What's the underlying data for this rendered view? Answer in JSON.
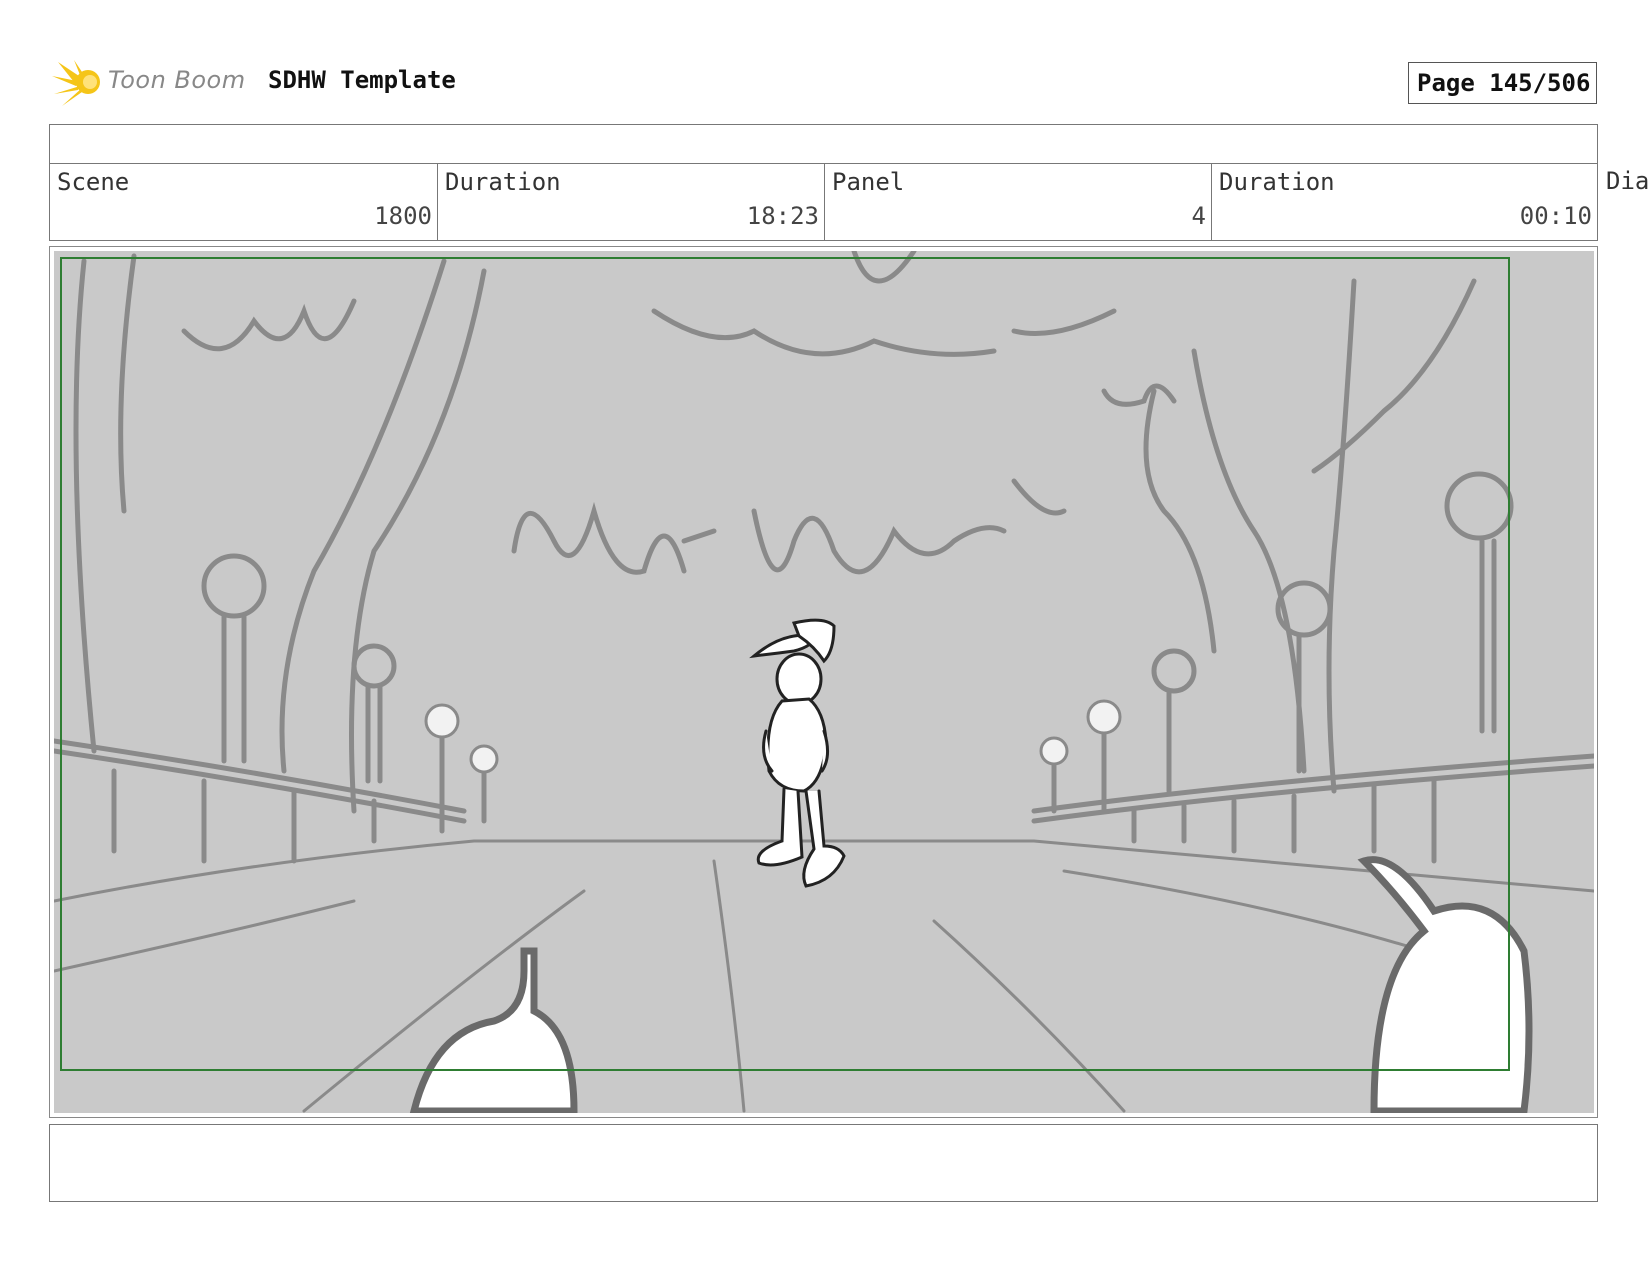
{
  "header": {
    "brand_name": "Toon Boom",
    "document_title": "SDHW Template",
    "page_indicator": "Page 145/506"
  },
  "info_table": {
    "title_row": "",
    "scene_label": "Scene",
    "scene_value": "1800",
    "scene_duration_label": "Duration",
    "scene_duration_value": "18:23",
    "panel_label": "Panel",
    "panel_value": "4",
    "panel_duration_label": "Duration",
    "panel_duration_value": "00:10",
    "dialogue_label": "Dia"
  },
  "panel_image": {
    "icon": "storyboard-sketch-image"
  },
  "notes": {
    "text": ""
  },
  "colors": {
    "logo_yellow": "#f5c518",
    "safe_area_green": "#2e7d32",
    "sketch_background": "#c9c9c9",
    "sketch_stroke": "#8a8a8a"
  }
}
